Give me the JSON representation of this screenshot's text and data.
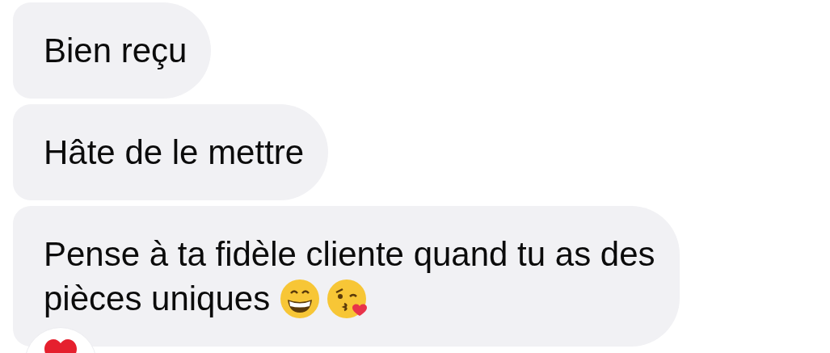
{
  "messages": [
    {
      "lines": [
        "Bien reçu"
      ]
    },
    {
      "lines": [
        "Hâte de le mettre"
      ]
    },
    {
      "lines": [
        "Pense à ta fidèle cliente quand tu as des",
        "pièces uniques"
      ],
      "emojis": [
        {
          "kind": "grin"
        },
        {
          "kind": "kiss"
        }
      ],
      "reaction": {
        "kind": "heart"
      }
    }
  ]
}
